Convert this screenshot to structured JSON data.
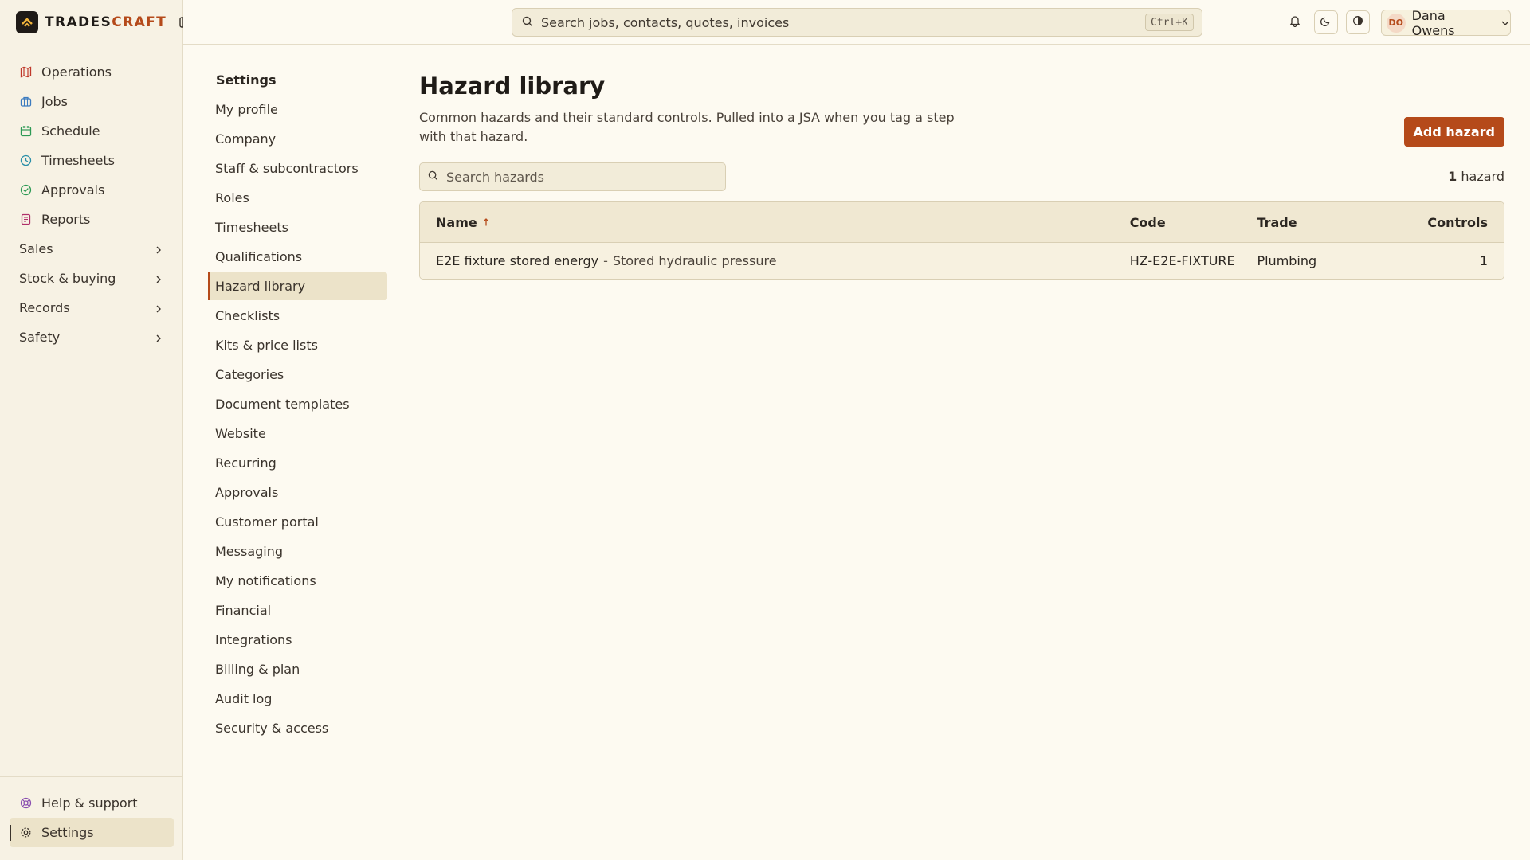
{
  "brand": {
    "name_part1": "TRADES",
    "name_part2": "CRAFT"
  },
  "sidebar": {
    "items": [
      {
        "label": "Operations",
        "icon": "map-icon",
        "color": "#c0392b"
      },
      {
        "label": "Jobs",
        "icon": "briefcase-icon",
        "color": "#3b7bbf"
      },
      {
        "label": "Schedule",
        "icon": "calendar-icon",
        "color": "#2e9a55"
      },
      {
        "label": "Timesheets",
        "icon": "clock-icon",
        "color": "#2a8fa8"
      },
      {
        "label": "Approvals",
        "icon": "check-circle-icon",
        "color": "#2e9a55"
      },
      {
        "label": "Reports",
        "icon": "report-icon",
        "color": "#b0306a"
      }
    ],
    "groups": [
      {
        "label": "Sales"
      },
      {
        "label": "Stock & buying"
      },
      {
        "label": "Records"
      },
      {
        "label": "Safety"
      }
    ],
    "bottom": [
      {
        "label": "Help & support",
        "icon": "lifebuoy-icon",
        "color": "#8a4fb0"
      },
      {
        "label": "Settings",
        "icon": "gear-icon",
        "color": "#3a332c"
      }
    ]
  },
  "topbar": {
    "search_placeholder": "Search jobs, contacts, quotes, invoices",
    "shortcut": "Ctrl+K",
    "user_initials": "DO",
    "user_name": "Dana Owens"
  },
  "settings_nav": {
    "title": "Settings",
    "items": [
      "My profile",
      "Company",
      "Staff & subcontractors",
      "Roles",
      "Timesheets",
      "Qualifications",
      "Hazard library",
      "Checklists",
      "Kits & price lists",
      "Categories",
      "Document templates",
      "Website",
      "Recurring",
      "Approvals",
      "Customer portal",
      "Messaging",
      "My notifications",
      "Financial",
      "Integrations",
      "Billing & plan",
      "Audit log",
      "Security & access"
    ],
    "active": "Hazard library"
  },
  "main": {
    "title": "Hazard library",
    "description": "Common hazards and their standard controls. Pulled into a JSA when you tag a step with that hazard.",
    "add_button": "Add hazard",
    "search_placeholder": "Search hazards",
    "count_number": "1",
    "count_label": "hazard",
    "table": {
      "headers": {
        "name": "Name",
        "code": "Code",
        "trade": "Trade",
        "controls": "Controls"
      },
      "rows": [
        {
          "name": "E2E fixture stored energy",
          "separator": "-",
          "subtitle": "Stored hydraulic pressure",
          "code": "HZ-E2E-FIXTURE",
          "trade": "Plumbing",
          "controls": "1"
        }
      ]
    }
  },
  "colors": {
    "accent": "#b54a1a",
    "background": "#fdfaf1",
    "sidebar": "#f7f2e4"
  }
}
